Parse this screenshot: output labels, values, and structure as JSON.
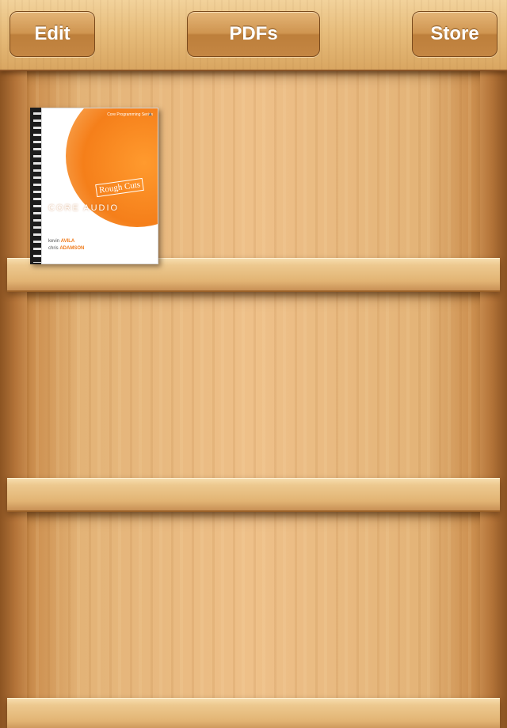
{
  "toolbar": {
    "edit_label": "Edit",
    "pdfs_label": "PDFs",
    "store_label": "Store"
  },
  "shelf": {
    "books": [
      {
        "series": "Core Programming Series",
        "badge": "Rough Cuts",
        "title": "CORE AUDIO",
        "authors": [
          {
            "first": "kevin",
            "last": "AVILA"
          },
          {
            "first": "chris",
            "last": "ADAMSON"
          }
        ]
      }
    ]
  },
  "colors": {
    "wood_light": "#eec089",
    "wood_dark": "#8c5422",
    "cover_orange": "#f57f1a"
  }
}
